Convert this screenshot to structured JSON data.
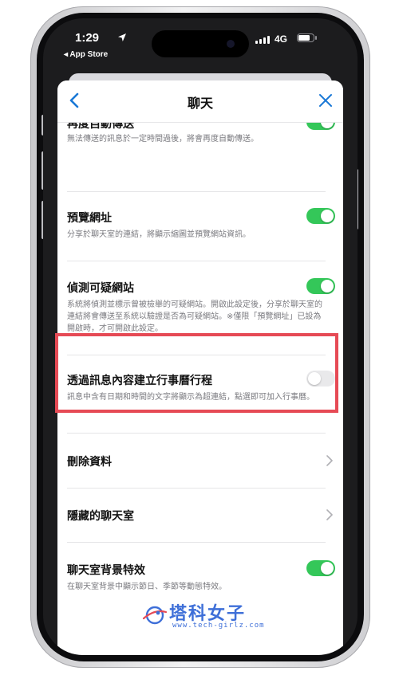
{
  "status_bar": {
    "time": "1:29",
    "back_app": "◂ App Store",
    "network": "4G",
    "battery_level": 0.8
  },
  "nav": {
    "title": "聊天",
    "back_icon": "chevron-left-icon",
    "close_icon": "close-icon"
  },
  "settings": [
    {
      "title": "再度自動傳送",
      "desc": "無法傳送的訊息於一定時間過後，將會再度自動傳送。",
      "toggle": true
    },
    {
      "title": "預覽網址",
      "desc": "分享於聊天室的連結，將顯示縮圖並預覽網站資訊。",
      "toggle": true
    },
    {
      "title": "偵測可疑網站",
      "desc": "系統將偵測並標示曾被檢舉的可疑網站。開啟此設定後，分享於聊天室的連結將會傳送至系統以驗證是否為可疑網站。※僅限「預覽網址」已設為開啟時，才可開啟此設定。",
      "toggle": true
    },
    {
      "title": "透過訊息內容建立行事曆行程",
      "desc": "訊息中含有日期和時間的文字將顯示為超連結，點選即可加入行事曆。",
      "toggle": false
    },
    {
      "title": "刪除資料",
      "chevron": true
    },
    {
      "title": "隱藏的聊天室",
      "chevron": true
    },
    {
      "title": "聊天室背景特效",
      "desc": "在聊天室背景中顯示節日、季節等動態特效。",
      "toggle": true
    }
  ],
  "watermark": {
    "name": "塔科女子",
    "url": "www.tech-girlz.com"
  },
  "colors": {
    "toggle_on": "#34c759",
    "toggle_off": "#e9e9eb",
    "accent": "#1a78d6",
    "highlight": "#e64a55"
  }
}
